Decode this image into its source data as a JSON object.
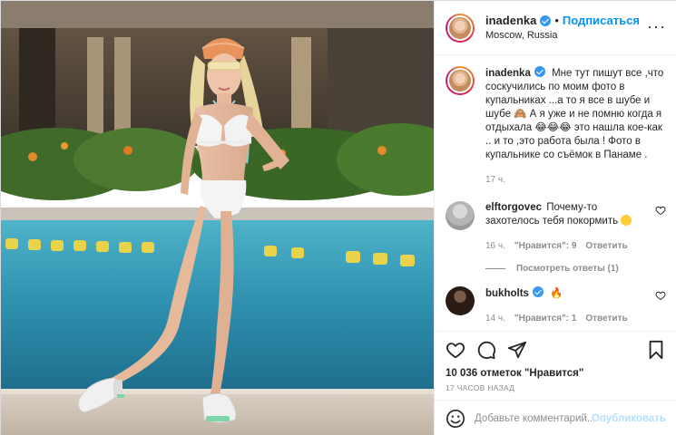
{
  "post": {
    "author": {
      "username": "inadenka",
      "location": "Moscow, Russia",
      "follow_label": "Подписаться",
      "dot": "•"
    },
    "caption": {
      "username": "inadenka",
      "text": "Мне тут пишут все ,что соскучились по моим фото в купальниках ...а то я все в шубе и шубе 🙈 А я уже и не помню когда я отдыхала 😂😂😂 это нашла кое-как .. и то ,это работа была ! Фото в купальнике со съёмок в Панаме .",
      "time": "17 ч."
    },
    "comments": [
      {
        "username": "elftorgovec",
        "text": "Почему-то захотелось тебя покормить",
        "time": "16 ч.",
        "likes": "\"Нравится\": 9",
        "reply_label": "Ответить",
        "view_replies": "Посмотреть ответы (1)"
      },
      {
        "username": "bukholts",
        "text": "🔥",
        "time": "14 ч.",
        "likes": "\"Нравится\": 1",
        "reply_label": "Ответить"
      }
    ],
    "likes_count": "10 036 отметок \"Нравится\"",
    "timestamp": "17 ЧАСОВ НАЗАД",
    "comment_input": {
      "placeholder": "Добавьте комментарий...",
      "publish_label": "Опубликовать"
    },
    "icons": {
      "verified": "verified-badge-icon",
      "more": "more-options-icon",
      "like": "heart-icon",
      "comment": "comment-icon",
      "share": "share-icon",
      "save": "bookmark-icon",
      "emoji": "smile-icon"
    },
    "colors": {
      "link_blue": "#0095f6",
      "verified_blue": "#3897f0",
      "muted_text": "#8e8e8e",
      "publish_disabled": "#b2dffc"
    }
  }
}
